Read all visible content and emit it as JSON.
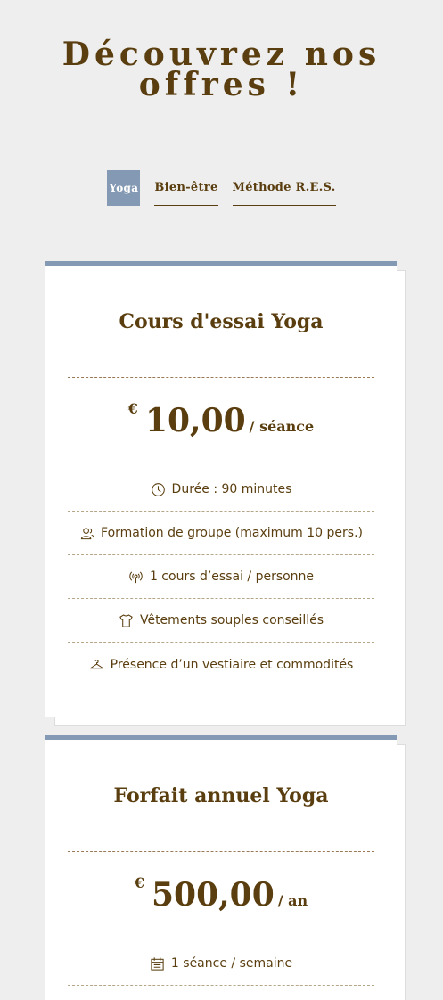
{
  "header": {
    "title_line1": "Découvrez nos",
    "title_line2": "offres !"
  },
  "tabs": [
    {
      "label": "Yoga",
      "active": true
    },
    {
      "label": "Bien-être",
      "active": false
    },
    {
      "label": "Méthode R.E.S.",
      "active": false
    }
  ],
  "colors": {
    "accent": "#8499b3",
    "text": "#5a3e0f",
    "background": "#eeeeee"
  },
  "offers": [
    {
      "title": "Cours d'essai Yoga",
      "currency": "€",
      "amount": "10,00",
      "unit": "/ séance",
      "features": [
        {
          "icon": "clock-icon",
          "text": "Durée : 90 minutes"
        },
        {
          "icon": "group-icon",
          "text": "Formation de groupe (maximum 10 pers.)"
        },
        {
          "icon": "broadcast-icon",
          "text": "1 cours d’essai / personne"
        },
        {
          "icon": "tshirt-icon",
          "text": "Vêtements souples conseillés"
        },
        {
          "icon": "hanger-icon",
          "text": "Présence d’un vestiaire et commodités"
        }
      ]
    },
    {
      "title": "Forfait annuel Yoga",
      "currency": "€",
      "amount": "500,00",
      "unit": "/ an",
      "features": [
        {
          "icon": "calendar-icon",
          "text": "1 séance / semaine"
        },
        {
          "icon": "clock-icon",
          "text": ""
        }
      ]
    }
  ]
}
